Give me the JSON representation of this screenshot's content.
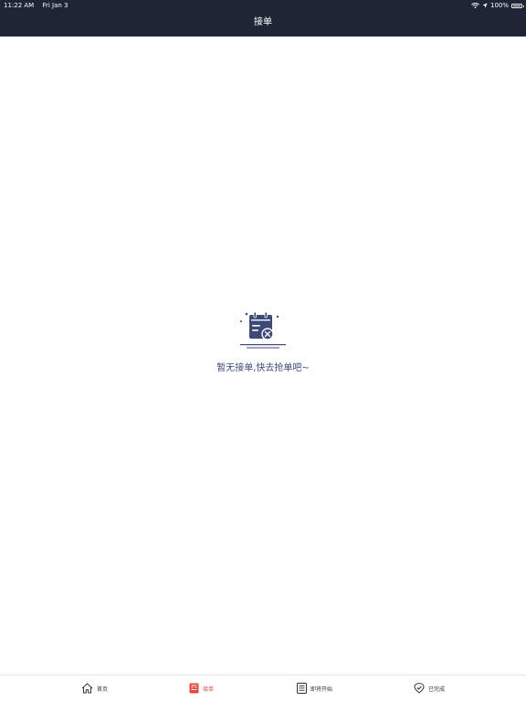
{
  "status_bar": {
    "time": "11:22 AM",
    "date": "Fri Jan 3",
    "battery": "100%"
  },
  "nav": {
    "title": "接单"
  },
  "empty_state": {
    "icon": "calendar-x-icon",
    "message": "暂无接单,快去抢单吧~"
  },
  "tabbar": {
    "items": [
      {
        "label": "首页",
        "icon": "home-icon",
        "active": false
      },
      {
        "label": "接单",
        "icon": "order-icon",
        "active": true
      },
      {
        "label": "即将开始",
        "icon": "list-icon",
        "active": false
      },
      {
        "label": "已完成",
        "icon": "check-shield-icon",
        "active": false
      }
    ]
  },
  "colors": {
    "header_bg": "#1f2535",
    "accent": "#e8453c",
    "empty_text": "#3b4a78"
  }
}
